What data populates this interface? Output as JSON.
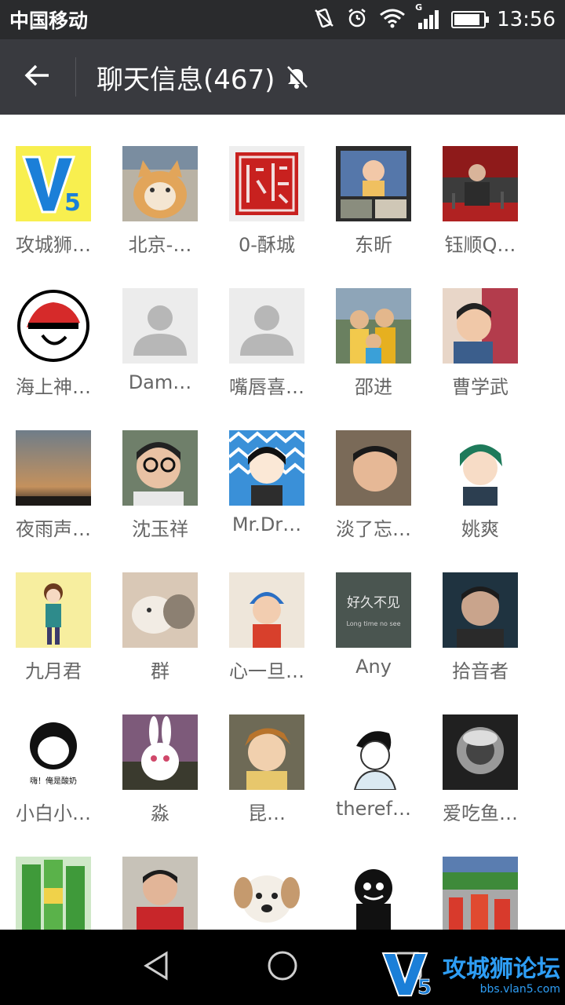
{
  "status_bar": {
    "carrier": "中国移动",
    "time": "13:56",
    "network_label": "G"
  },
  "header": {
    "title": "聊天信息(467)"
  },
  "members": [
    {
      "name": "攻城狮…",
      "avatar": "v5-logo"
    },
    {
      "name": "北京-…",
      "avatar": "cat-photo"
    },
    {
      "name": "0-酥城",
      "avatar": "red-seal"
    },
    {
      "name": "东昕",
      "avatar": "baby-collage"
    },
    {
      "name": "钰顺Q…",
      "avatar": "podium-photo"
    },
    {
      "name": "海上神…",
      "avatar": "red-hat-logo"
    },
    {
      "name": "Dam…",
      "avatar": "default-avatar"
    },
    {
      "name": "嘴唇喜…",
      "avatar": "default-avatar"
    },
    {
      "name": "邵进",
      "avatar": "family-photo"
    },
    {
      "name": "曹学武",
      "avatar": "child-photo"
    },
    {
      "name": "夜雨声…",
      "avatar": "sunset-sky"
    },
    {
      "name": "沈玉祥",
      "avatar": "glasses-selfie"
    },
    {
      "name": "Mr.Dr…",
      "avatar": "cartoon-boy-zigzag"
    },
    {
      "name": "淡了忘…",
      "avatar": "selfie-photo"
    },
    {
      "name": "姚爽",
      "avatar": "cartoon-boy-green"
    },
    {
      "name": "九月君",
      "avatar": "cartoon-girl"
    },
    {
      "name": "群",
      "avatar": "cat-dog-photo"
    },
    {
      "name": "心一旦…",
      "avatar": "baby-hat"
    },
    {
      "name": "Any",
      "avatar": "chalkboard-text"
    },
    {
      "name": "拾音者",
      "avatar": "actor-photo"
    },
    {
      "name": "小白小…",
      "avatar": "meme-face"
    },
    {
      "name": "淼",
      "avatar": "bunny-cartoon"
    },
    {
      "name": "昆…",
      "avatar": "anime-man"
    },
    {
      "name": "theref…",
      "avatar": "sketch-boy"
    },
    {
      "name": "爱吃鱼…",
      "avatar": "bw-photo"
    },
    {
      "name": "",
      "avatar": "green-bottles"
    },
    {
      "name": "",
      "avatar": "man-red-shirt"
    },
    {
      "name": "",
      "avatar": "puppy"
    },
    {
      "name": "",
      "avatar": "dark-figure"
    },
    {
      "name": "",
      "avatar": "stadium-crowd"
    }
  ],
  "avatar_text": {
    "v5": "V5",
    "chalkboard_line1": "好久不见",
    "chalkboard_line2": "Long time no see",
    "meme_caption": "嗨！俺是酸奶"
  },
  "watermark": {
    "title": "攻城狮论坛",
    "url": "bbs.vlan5.com"
  },
  "colors": {
    "status_bar": "#2a2b2d",
    "title_bar": "#393a3f",
    "name_text": "#666666",
    "nav_bar": "#000000",
    "watermark": "#2e9ef5"
  }
}
